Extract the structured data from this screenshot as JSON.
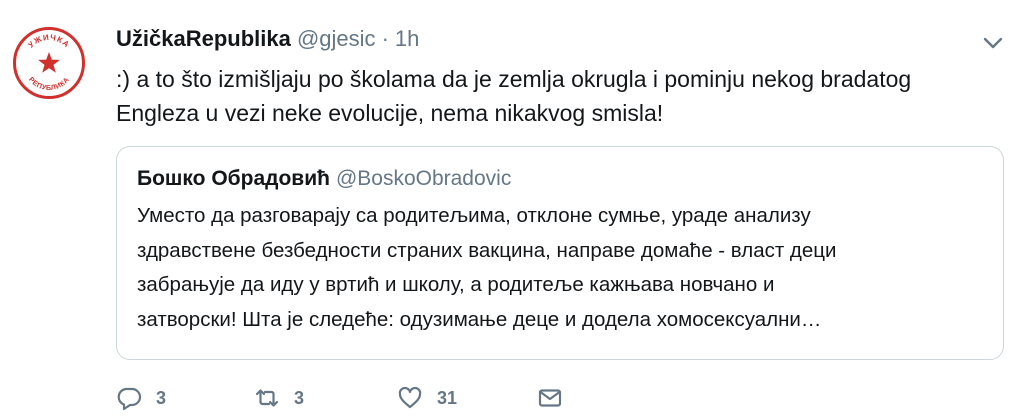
{
  "tweet": {
    "display_name": "UžičkaRepublika",
    "handle": "@gjesic",
    "separator": "·",
    "time": "1h",
    "text": ":) a to što izmišljaju po školama da je zemlja okrugla i pominju nekog bradatog Engleza u vezi neke evolucije, nema nikakvog smisla!",
    "avatar_text": "УЖИЧКА РЕПУБЛИКА"
  },
  "quote": {
    "display_name": "Бошко Обрадовић",
    "handle": "@BoskoObradovic",
    "lines": [
      "Уместо да разговарају са родитељима, отклоне сумње, ураде анализу",
      "здравствене безбедности страних вакцина, направе домаће - власт деци",
      "забрањује да иду у вртић и школу, а родитеље кажњава новчано и",
      "затворски! Шта је следеће: одузимање деце и додела хомосексуални…"
    ]
  },
  "actions": {
    "reply_count": "3",
    "retweet_count": "3",
    "like_count": "31"
  },
  "icons": {
    "avatar": "star-seal-icon",
    "menu": "chevron-down-icon",
    "reply": "reply-icon",
    "retweet": "retweet-icon",
    "like": "heart-icon",
    "message": "direct-message-icon"
  },
  "colors": {
    "text": "#14171a",
    "secondary": "#657786",
    "border": "#ccd6dd",
    "avatar_red": "#d0312d"
  }
}
